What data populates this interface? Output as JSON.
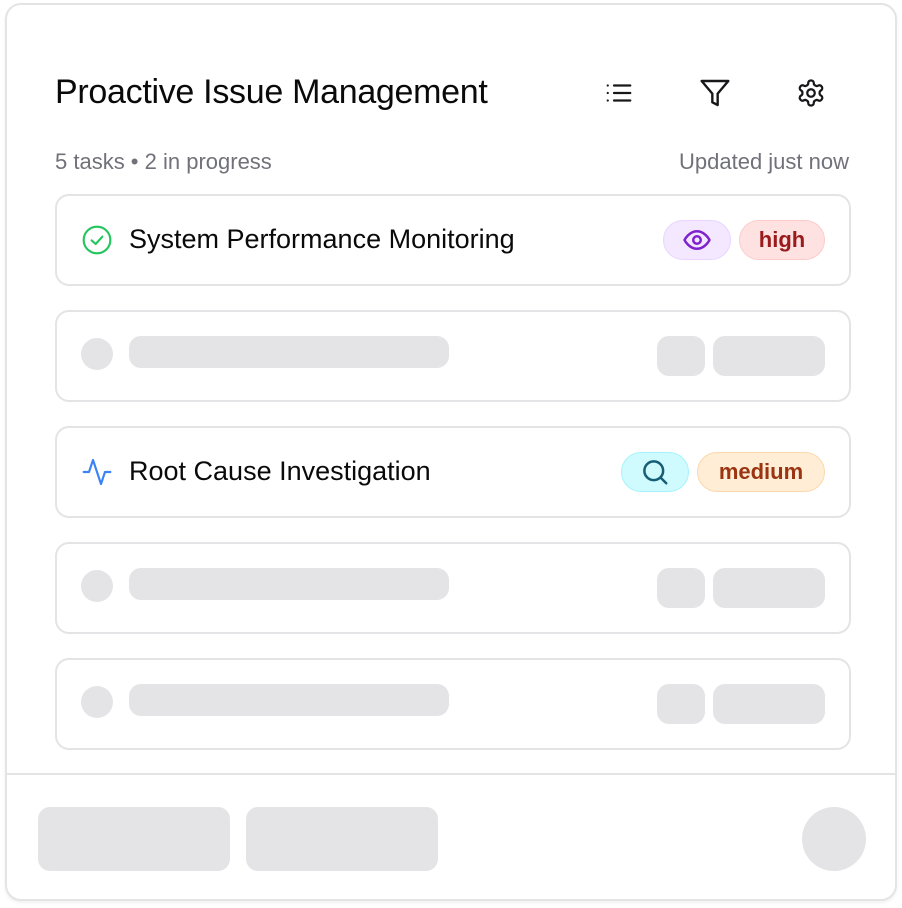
{
  "header": {
    "title": "Proactive Issue Management",
    "icons": [
      "list-icon",
      "filter-icon",
      "settings-icon"
    ]
  },
  "summary": {
    "counts": "5 tasks • 2 in progress",
    "updated": "Updated just now"
  },
  "tasks": [
    {
      "title": "System Performance Monitoring",
      "status_icon": "check-circle-icon",
      "status_color": "#22c55e",
      "category_icon": "eye-icon",
      "priority": "high",
      "priority_color": "#991b1b"
    },
    {
      "title": "Root Cause Investigation",
      "status_icon": "activity-icon",
      "status_color": "#3b82f6",
      "category_icon": "search-icon",
      "priority": "medium",
      "priority_color": "#9a3412"
    }
  ],
  "loading_placeholders": 3
}
